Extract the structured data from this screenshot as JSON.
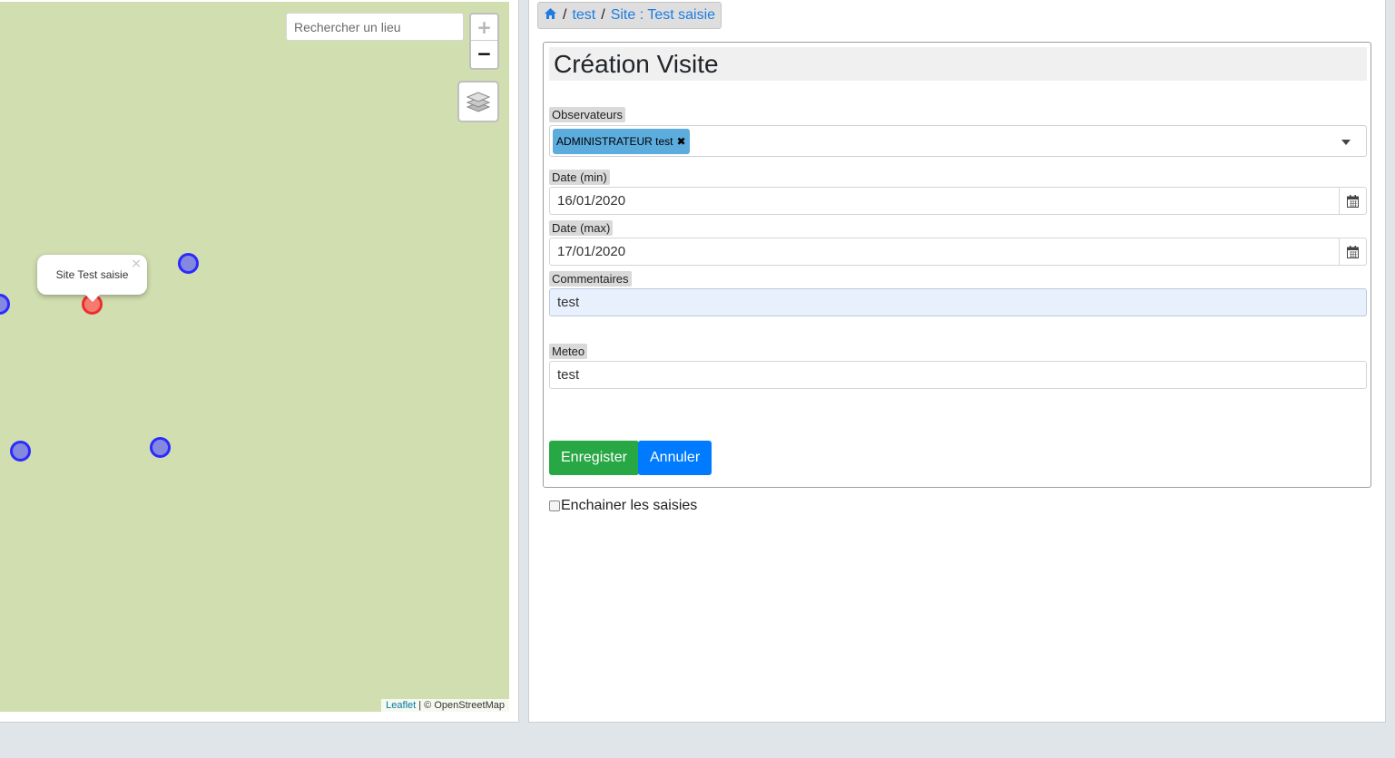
{
  "map": {
    "search_placeholder": "Rechercher un lieu",
    "zoom_in": "+",
    "zoom_out": "−",
    "popup_text": "Site Test saisie",
    "popup_close": "×",
    "attribution_link": "Leaflet",
    "attribution_text": " | © OpenStreetMap",
    "colors": {
      "background": "#d1deb0",
      "marker_blue": "#2b2bff",
      "marker_red": "#ee2e2e"
    }
  },
  "breadcrumb": {
    "home_icon": "home-icon",
    "items": [
      "test",
      "Site : Test saisie"
    ],
    "separator": "/"
  },
  "form": {
    "title": "Création Visite",
    "observateurs": {
      "label": "Observateurs",
      "chip": "ADMINISTRATEUR test"
    },
    "date_min": {
      "label": "Date (min)",
      "value": "16/01/2020"
    },
    "date_max": {
      "label": "Date (max)",
      "value": "17/01/2020"
    },
    "commentaires": {
      "label": "Commentaires",
      "value": "test"
    },
    "meteo": {
      "label": "Meteo",
      "value": "test"
    },
    "save_label": "Enregister",
    "cancel_label": "Annuler",
    "chain_label": "Enchainer les saisies",
    "colors": {
      "save": "#28a745",
      "cancel": "#007bff",
      "chip": "#5cacde"
    }
  }
}
